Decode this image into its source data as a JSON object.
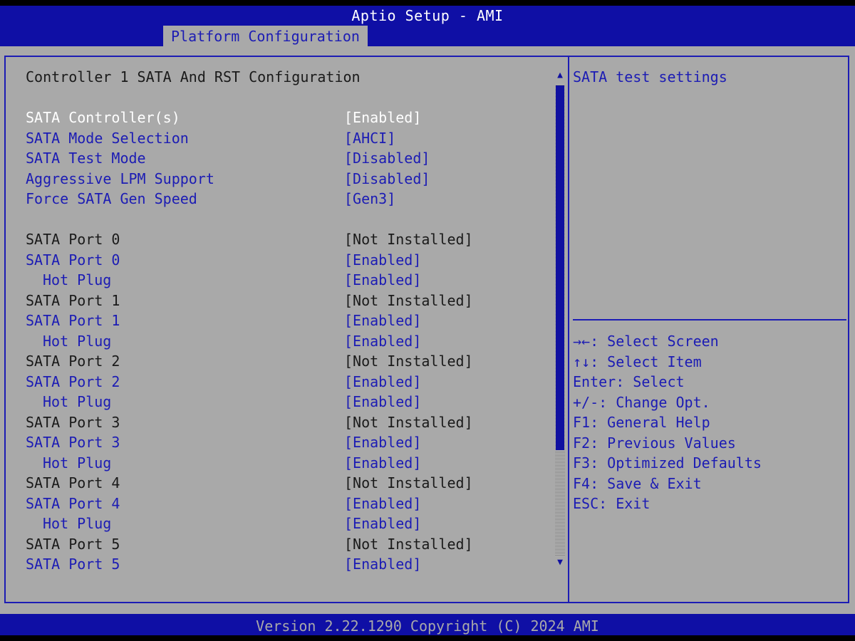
{
  "header": {
    "app_title": "Aptio Setup - AMI",
    "active_tab": "Platform Configuration"
  },
  "main": {
    "section_title": "Controller 1 SATA And RST Configuration",
    "items": [
      {
        "label": "SATA Controller(s)",
        "value": "[Enabled]",
        "kind": "selected"
      },
      {
        "label": "SATA Mode Selection",
        "value": "[AHCI]",
        "kind": "option"
      },
      {
        "label": "SATA Test Mode",
        "value": "[Disabled]",
        "kind": "option"
      },
      {
        "label": "Aggressive LPM Support",
        "value": "[Disabled]",
        "kind": "option"
      },
      {
        "label": "Force SATA Gen Speed",
        "value": "[Gen3]",
        "kind": "option"
      },
      {
        "label": "SATA Port 0",
        "value": "[Not Installed]",
        "kind": "info"
      },
      {
        "label": "SATA Port 0",
        "value": "[Enabled]",
        "kind": "option"
      },
      {
        "label": "Hot Plug",
        "value": "[Enabled]",
        "kind": "option"
      },
      {
        "label": "SATA Port 1",
        "value": "[Not Installed]",
        "kind": "info"
      },
      {
        "label": "SATA Port 1",
        "value": "[Enabled]",
        "kind": "option"
      },
      {
        "label": "Hot Plug",
        "value": "[Enabled]",
        "kind": "option"
      },
      {
        "label": "SATA Port 2",
        "value": "[Not Installed]",
        "kind": "info"
      },
      {
        "label": "SATA Port 2",
        "value": "[Enabled]",
        "kind": "option"
      },
      {
        "label": "Hot Plug",
        "value": "[Enabled]",
        "kind": "option"
      },
      {
        "label": "SATA Port 3",
        "value": "[Not Installed]",
        "kind": "info"
      },
      {
        "label": "SATA Port 3",
        "value": "[Enabled]",
        "kind": "option"
      },
      {
        "label": "Hot Plug",
        "value": "[Enabled]",
        "kind": "option"
      },
      {
        "label": "SATA Port 4",
        "value": "[Not Installed]",
        "kind": "info"
      },
      {
        "label": "SATA Port 4",
        "value": "[Enabled]",
        "kind": "option"
      },
      {
        "label": "Hot Plug",
        "value": "[Enabled]",
        "kind": "option"
      },
      {
        "label": "SATA Port 5",
        "value": "[Not Installed]",
        "kind": "info"
      },
      {
        "label": "SATA Port 5",
        "value": "[Enabled]",
        "kind": "option"
      }
    ]
  },
  "help": {
    "description": "SATA test settings",
    "keys": [
      "→←: Select Screen",
      "↑↓: Select Item",
      "Enter: Select",
      "+/-: Change Opt.",
      "F1: General Help",
      "F2: Previous Values",
      "F3: Optimized Defaults",
      "F4: Save & Exit",
      "ESC: Exit"
    ]
  },
  "scrollbar": {
    "up_arrow": "▲",
    "down_arrow": "▼"
  },
  "footer": {
    "version": "Version 2.22.1290 Copyright (C) 2024 AMI"
  },
  "colors": {
    "header_blue": "#0f0fa5",
    "panel_gray": "#a9a9a9",
    "option_blue": "#1c1cb4",
    "selected_white": "#ffffff",
    "static_text": "#1a1a1a"
  }
}
